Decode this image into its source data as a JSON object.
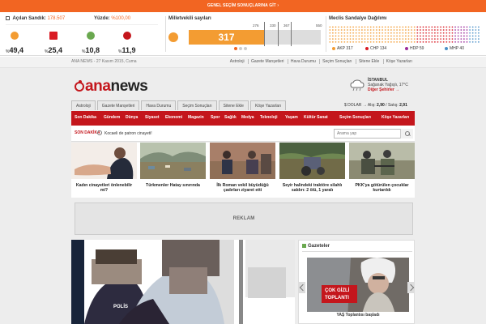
{
  "banner": {
    "label": "GENEL SEÇİM SONUÇLARINA GİT ›"
  },
  "election": {
    "opened_label": "Açılan Sandık:",
    "opened_value": "178.507",
    "ratio_label": "Yüzde:",
    "ratio_value": "%100,00",
    "parties": [
      {
        "name": "AKP",
        "pct": "49,4",
        "color": "#f39c32"
      },
      {
        "name": "CHP",
        "pct": "25,4",
        "color": "#d91c24"
      },
      {
        "name": "HDP",
        "pct": "10,8",
        "color": "#6aa84f"
      },
      {
        "name": "MHP",
        "pct": "11,9",
        "color": "#c4161c"
      }
    ],
    "seat_title": "Milletvekili sayıları",
    "seat_value": "317",
    "seat_ticks": [
      "276",
      "330",
      "367",
      "550"
    ],
    "distribution_title": "Meclis Sandalye Dağılımı",
    "legend": [
      {
        "party": "AKP",
        "seats": "317",
        "color": "#f39c32"
      },
      {
        "party": "CHP",
        "seats": "134",
        "color": "#d91c24"
      },
      {
        "party": "HDP",
        "seats": "59",
        "color": "#9b2c9b"
      },
      {
        "party": "MHP",
        "seats": "40",
        "color": "#4a90c8"
      }
    ]
  },
  "top": {
    "date": "ANA NEWS - 27 Kasım 2015, Cuma",
    "links": [
      "Astroloji",
      "Gazete Manşetleri",
      "Hava Durumu",
      "Seçim Sonuçları",
      "Sitene Ekle",
      "Köşe Yazarları"
    ]
  },
  "logo": {
    "prefix": "ana",
    "suffix": "news"
  },
  "weather": {
    "city": "İSTANBUL",
    "desc": "Sağanak Yağışlı, 17°C",
    "link": "Diğer Şehirler →"
  },
  "tabs": [
    "Astroloji",
    "Gazete Manşetleri",
    "Hava Durumu",
    "Seçim Sonuçları",
    "Sitene Ekle",
    "Köşe Yazarları"
  ],
  "currency": {
    "label": "$ DOLAR →",
    "buy_label": "Alış:",
    "buy_value": "2,90",
    "sep": "/",
    "sell_label": "Satış:",
    "sell_value": "2,91"
  },
  "nav": [
    "Son Dakika",
    "Gündem",
    "Dünya",
    "Siyaset",
    "Ekonomi",
    "Magazin",
    "Spor",
    "Sağlık",
    "Medya",
    "Teknoloji",
    "Yaşam",
    "Kültür Sanat",
    "Seçim Sonuçları",
    "Köşe Yazarları"
  ],
  "breaking": {
    "tag": "SON DAKİKA",
    "text": "Kocaeli de patron cinayeti!",
    "search_placeholder": "Arama yap"
  },
  "thumbs": [
    {
      "caption": "Kadın cinayetleri önlenebilir mi?"
    },
    {
      "caption": "Türkmenler Hatay sınırında"
    },
    {
      "caption": "İlk Roman vekil büyüdüğü çadırları ziyaret etti"
    },
    {
      "caption": "Seyir halindeki traktöre silahlı saldırı: 2 ölü, 1 yaralı"
    },
    {
      "caption": "PKK'ya götürülen çocuklar kurtarıldı"
    }
  ],
  "ad": {
    "label": "REKLAM"
  },
  "gazette": {
    "title": "Gazeteler",
    "image_text_1": "ÇOK GİZLİ",
    "image_text_2": "TOPLANTI",
    "caption": "YAŞ Toplantısı başladı"
  }
}
